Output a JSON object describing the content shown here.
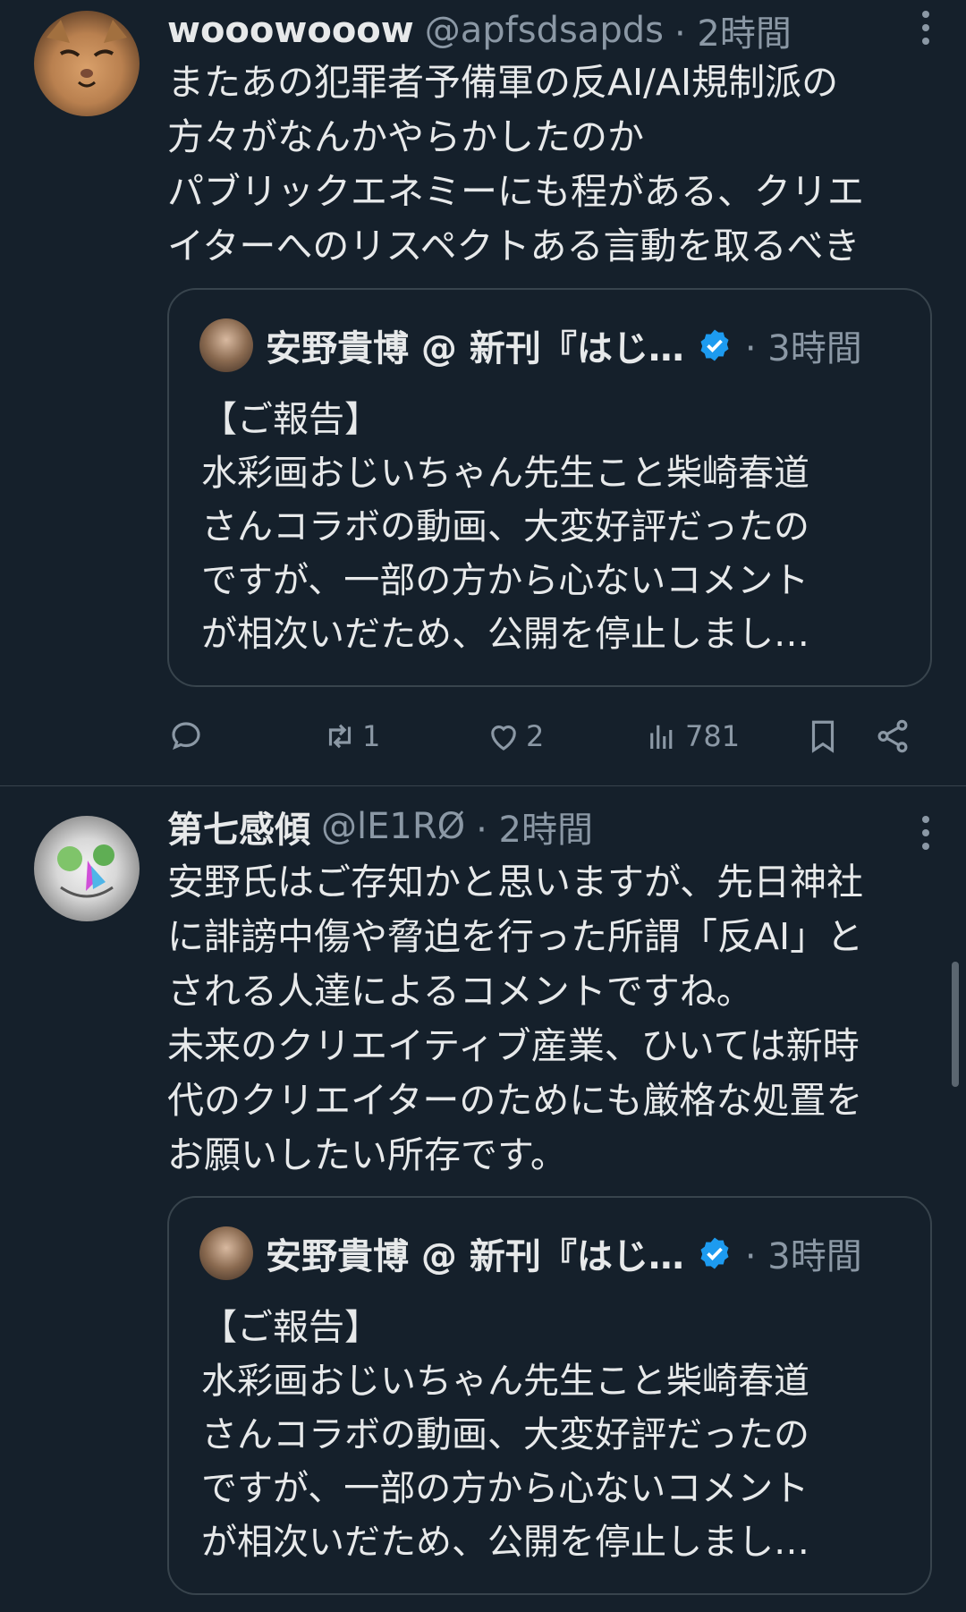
{
  "tweets": [
    {
      "display_name": "wooowooow",
      "handle": "@apfsdsapds",
      "time": "· 2時間",
      "text": "またあの犯罪者予備軍の反AI/AI規制派の\n方々がなんかやらかしたのか\nパブリックエネミーにも程がある、クリエ\nイターへのリスペクトある言動を取るべき",
      "quote": {
        "name": "安野貴博 @ 新刊『はじ…",
        "time": "· 3時間",
        "text": "【ご報告】\n水彩画おじいちゃん先生こと柴崎春道\nさんコラボの動画、大変好評だったの\nですが、一部の方から心ないコメント\nが相次いだため、公開を停止しまし…"
      },
      "actions": {
        "reply_count": "",
        "retweet_count": "1",
        "like_count": "2",
        "view_count": "781"
      }
    },
    {
      "display_name": "第七感傾",
      "handle": "@lE1RØ",
      "time": "· 2時間",
      "text": "安野氏はご存知かと思いますが、先日神社\nに誹謗中傷や脅迫を行った所謂「反AI」と\nされる人達によるコメントですね。\n未来のクリエイティブ産業、ひいては新時\n代のクリエイターのためにも厳格な処置を\nお願いしたい所存です。",
      "quote": {
        "name": "安野貴博 @ 新刊『はじ…",
        "time": "· 3時間",
        "text": "【ご報告】\n水彩画おじいちゃん先生こと柴崎春道\nさんコラボの動画、大変好評だったの\nですが、一部の方から心ないコメント\nが相次いだため、公開を停止しまし…"
      }
    }
  ],
  "colors": {
    "background": "#15202b",
    "text": "#e7e9ea",
    "muted": "#8b98a5",
    "border": "#38444d",
    "verified": "#1d9bf0"
  },
  "icons": [
    "reply-icon",
    "retweet-icon",
    "like-icon",
    "views-icon",
    "bookmark-icon",
    "share-icon",
    "more-icon",
    "verified-icon"
  ]
}
